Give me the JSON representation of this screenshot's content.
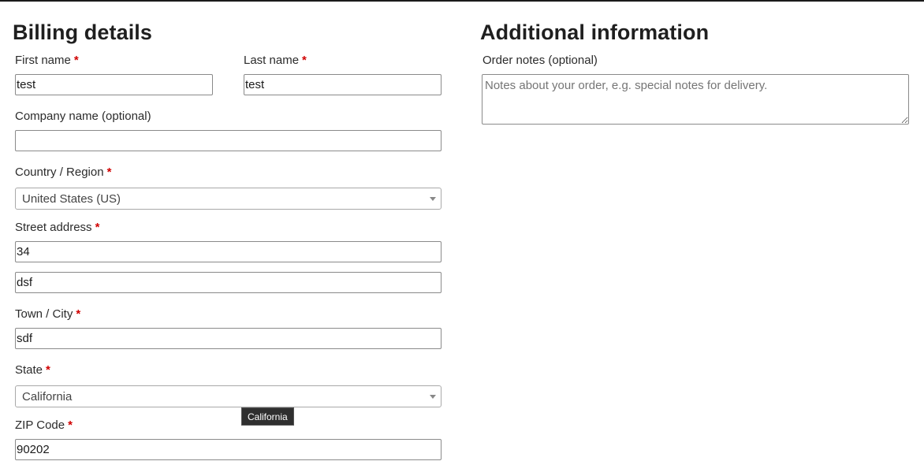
{
  "billing": {
    "title": "Billing details",
    "required_mark": "*",
    "first_name": {
      "label": "First name",
      "value": "test"
    },
    "last_name": {
      "label": "Last name",
      "value": "test"
    },
    "company": {
      "label": "Company name (optional)",
      "value": ""
    },
    "country": {
      "label": "Country / Region",
      "value": "United States (US)"
    },
    "street": {
      "label": "Street address",
      "line1": "34",
      "line2": "dsf"
    },
    "city": {
      "label": "Town / City",
      "value": "sdf"
    },
    "state": {
      "label": "State",
      "value": "California",
      "tooltip": "California"
    },
    "zip": {
      "label": "ZIP Code",
      "value": "90202"
    }
  },
  "additional": {
    "title": "Additional information",
    "notes": {
      "label": "Order notes (optional)",
      "placeholder": "Notes about your order, e.g. special notes for delivery.",
      "value": ""
    }
  },
  "colors": {
    "required": "#d00000",
    "tooltip_bg": "#2f2f2f"
  },
  "icons": {
    "select_caret": "chevron-down-icon"
  }
}
